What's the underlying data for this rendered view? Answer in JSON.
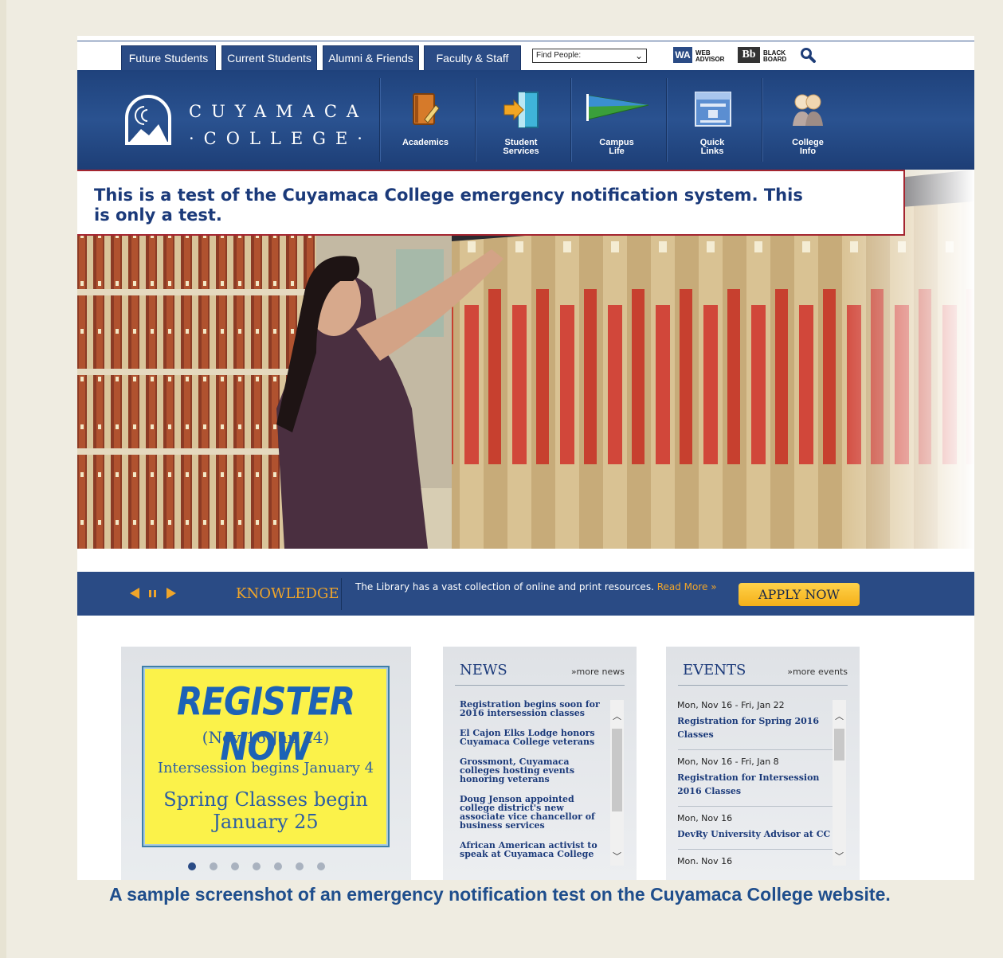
{
  "tabs": [
    "Future Students",
    "Current Students",
    "Alumni & Friends",
    "Faculty & Staff"
  ],
  "find_people": "Find People:",
  "tools": {
    "webadvisor_badge": "WA",
    "webadvisor_line1": "WEB",
    "webadvisor_line2": "ADVISOR",
    "blackboard_badge": "Bb",
    "blackboard_line1": "BLACK",
    "blackboard_line2": "BOARD"
  },
  "logo": {
    "line1": "CUYAMACA",
    "line2": "·COLLEGE·"
  },
  "nav": [
    {
      "line1": "Academics",
      "line2": "",
      "icon": "book-pencil-icon"
    },
    {
      "line1": "Student",
      "line2": "Services",
      "icon": "door-arrow-icon"
    },
    {
      "line1": "Campus",
      "line2": "Life",
      "icon": "pennant-icon"
    },
    {
      "line1": "Quick",
      "line2": "Links",
      "icon": "links-window-icon"
    },
    {
      "line1": "College",
      "line2": "Info",
      "icon": "people-icon"
    }
  ],
  "alert": {
    "text": "This is a test of the Cuyamaca College emergency notification system. This is only a test."
  },
  "knowledge": {
    "label": "KNOWLEDGE",
    "text": "The Library has a vast collection of online and print resources.",
    "more": "Read More »",
    "apply": "APPLY NOW"
  },
  "promo": {
    "title": "REGISTER NOW",
    "line1": "(Nov 16-Jan 24)",
    "line2": "Intersession begins January 4",
    "line3": "Spring Classes begin",
    "line4": "January 25",
    "slide_count": 7,
    "active_slide": 1
  },
  "news": {
    "title": "NEWS",
    "more": "»more news",
    "items": [
      "Registration begins soon for 2016 intersession classes",
      "El Cajon Elks Lodge honors Cuyamaca College veterans",
      "Grossmont, Cuyamaca colleges hosting events honoring veterans",
      "Doug Jenson appointed college district's new associate vice chancellor of business services",
      "African American activist to speak at Cuyamaca College"
    ]
  },
  "events": {
    "title": "EVENTS",
    "more": "»more events",
    "items": [
      {
        "date": "Mon, Nov 16 - Fri, Jan 22",
        "title": "Registration for Spring 2016 Classes"
      },
      {
        "date": "Mon, Nov 16 - Fri, Jan 8",
        "title": "Registration for Intersession 2016 Classes"
      },
      {
        "date": "Mon, Nov 16",
        "title": "DevRy University Advisor at CC"
      },
      {
        "date": "Mon, Nov 16",
        "title": ""
      }
    ]
  },
  "caption": "A sample screenshot of an emergency notification test on the Cuyamaca College website.",
  "colors": {
    "navy": "#2a4b85",
    "alert_border": "#a42530",
    "accent_gold": "#f0a52a"
  }
}
